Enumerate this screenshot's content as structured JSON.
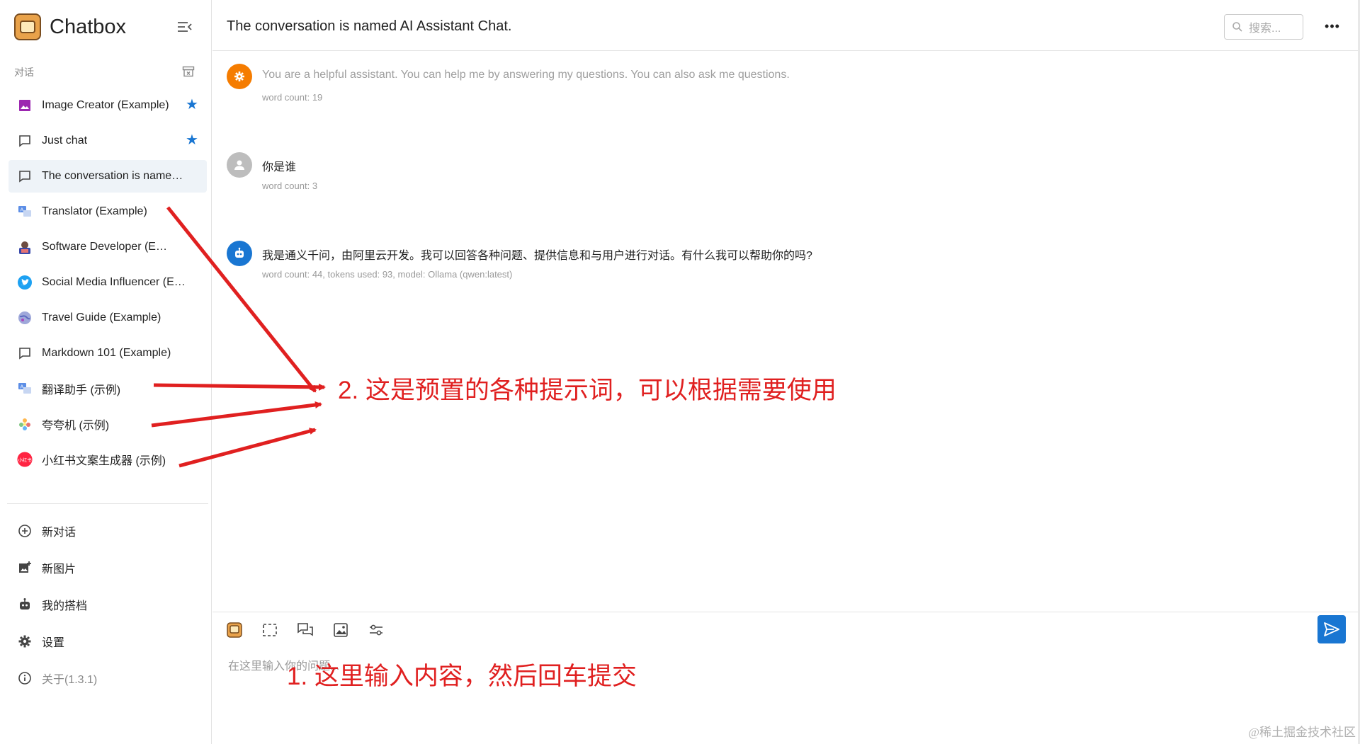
{
  "app": {
    "name": "Chatbox"
  },
  "sidebar": {
    "section_label": "对话",
    "conversations": [
      {
        "label": "Image Creator (Example)",
        "icon": "image-icon",
        "starred": true,
        "active": false
      },
      {
        "label": "Just chat",
        "icon": "chat-bubble-icon",
        "starred": true,
        "active": false
      },
      {
        "label": "The conversation is named AI Assistant Chat.",
        "icon": "chat-bubble-icon",
        "starred": false,
        "active": true
      },
      {
        "label": "Translator (Example)",
        "icon": "translator-avatar-icon",
        "starred": false,
        "active": false
      },
      {
        "label": "Software Developer (Example)",
        "icon": "developer-avatar-icon",
        "starred": false,
        "active": false
      },
      {
        "label": "Social Media Influencer (Example)",
        "icon": "twitter-bird-icon",
        "starred": false,
        "active": false
      },
      {
        "label": "Travel Guide (Example)",
        "icon": "globe-avatar-icon",
        "starred": false,
        "active": false
      },
      {
        "label": "Markdown 101 (Example)",
        "icon": "chat-bubble-icon",
        "starred": false,
        "active": false
      },
      {
        "label": "翻译助手 (示例)",
        "icon": "translator-avatar-icon",
        "starred": false,
        "active": false
      },
      {
        "label": "夸夸机 (示例)",
        "icon": "flower-avatar-icon",
        "starred": false,
        "active": false
      },
      {
        "label": "小红书文案生成器 (示例)",
        "icon": "xiaohongshu-logo-icon",
        "starred": false,
        "active": false
      }
    ],
    "xhs_logo_text": "小红书",
    "nav": [
      {
        "label": "新对话",
        "icon": "plus-circle-icon"
      },
      {
        "label": "新图片",
        "icon": "add-image-icon"
      },
      {
        "label": "我的搭档",
        "icon": "robot-icon"
      },
      {
        "label": "设置",
        "icon": "gear-icon"
      },
      {
        "label": "关于(1.3.1)",
        "icon": "info-icon"
      }
    ]
  },
  "header": {
    "title": "The conversation is named AI Assistant Chat.",
    "search_placeholder": "搜索...",
    "more_label": "•••"
  },
  "messages": [
    {
      "role": "system",
      "text": "You are a helpful assistant. You can help me by answering my questions. You can also ask me questions.",
      "meta": "word count: 19",
      "color": "#f57c00"
    },
    {
      "role": "user",
      "text": "你是谁",
      "meta": "word count: 3",
      "color": "#bdbdbd"
    },
    {
      "role": "assistant",
      "text": "我是通义千问，由阿里云开发。我可以回答各种问题、提供信息和与用户进行对话。有什么我可以帮助你的吗?",
      "meta": "word count: 44, tokens used: 93, model: Ollama (qwen:latest)",
      "color": "#1976d2"
    }
  ],
  "annotations": {
    "presets_note": "2. 这是预置的各种提示词，可以根据需要使用",
    "input_note": "1. 这里输入内容，然后回车提交",
    "color": "#e02020"
  },
  "composer": {
    "placeholder": "在这里输入你的问题...",
    "tools": [
      "chatbox-logo-icon",
      "dashed-select-icon",
      "chat-bubbles-icon",
      "image-icon",
      "sliders-icon"
    ]
  },
  "watermark": "@稀土掘金技术社区",
  "colors": {
    "accent": "#1976d2",
    "active_bg": "#eef3f8"
  }
}
